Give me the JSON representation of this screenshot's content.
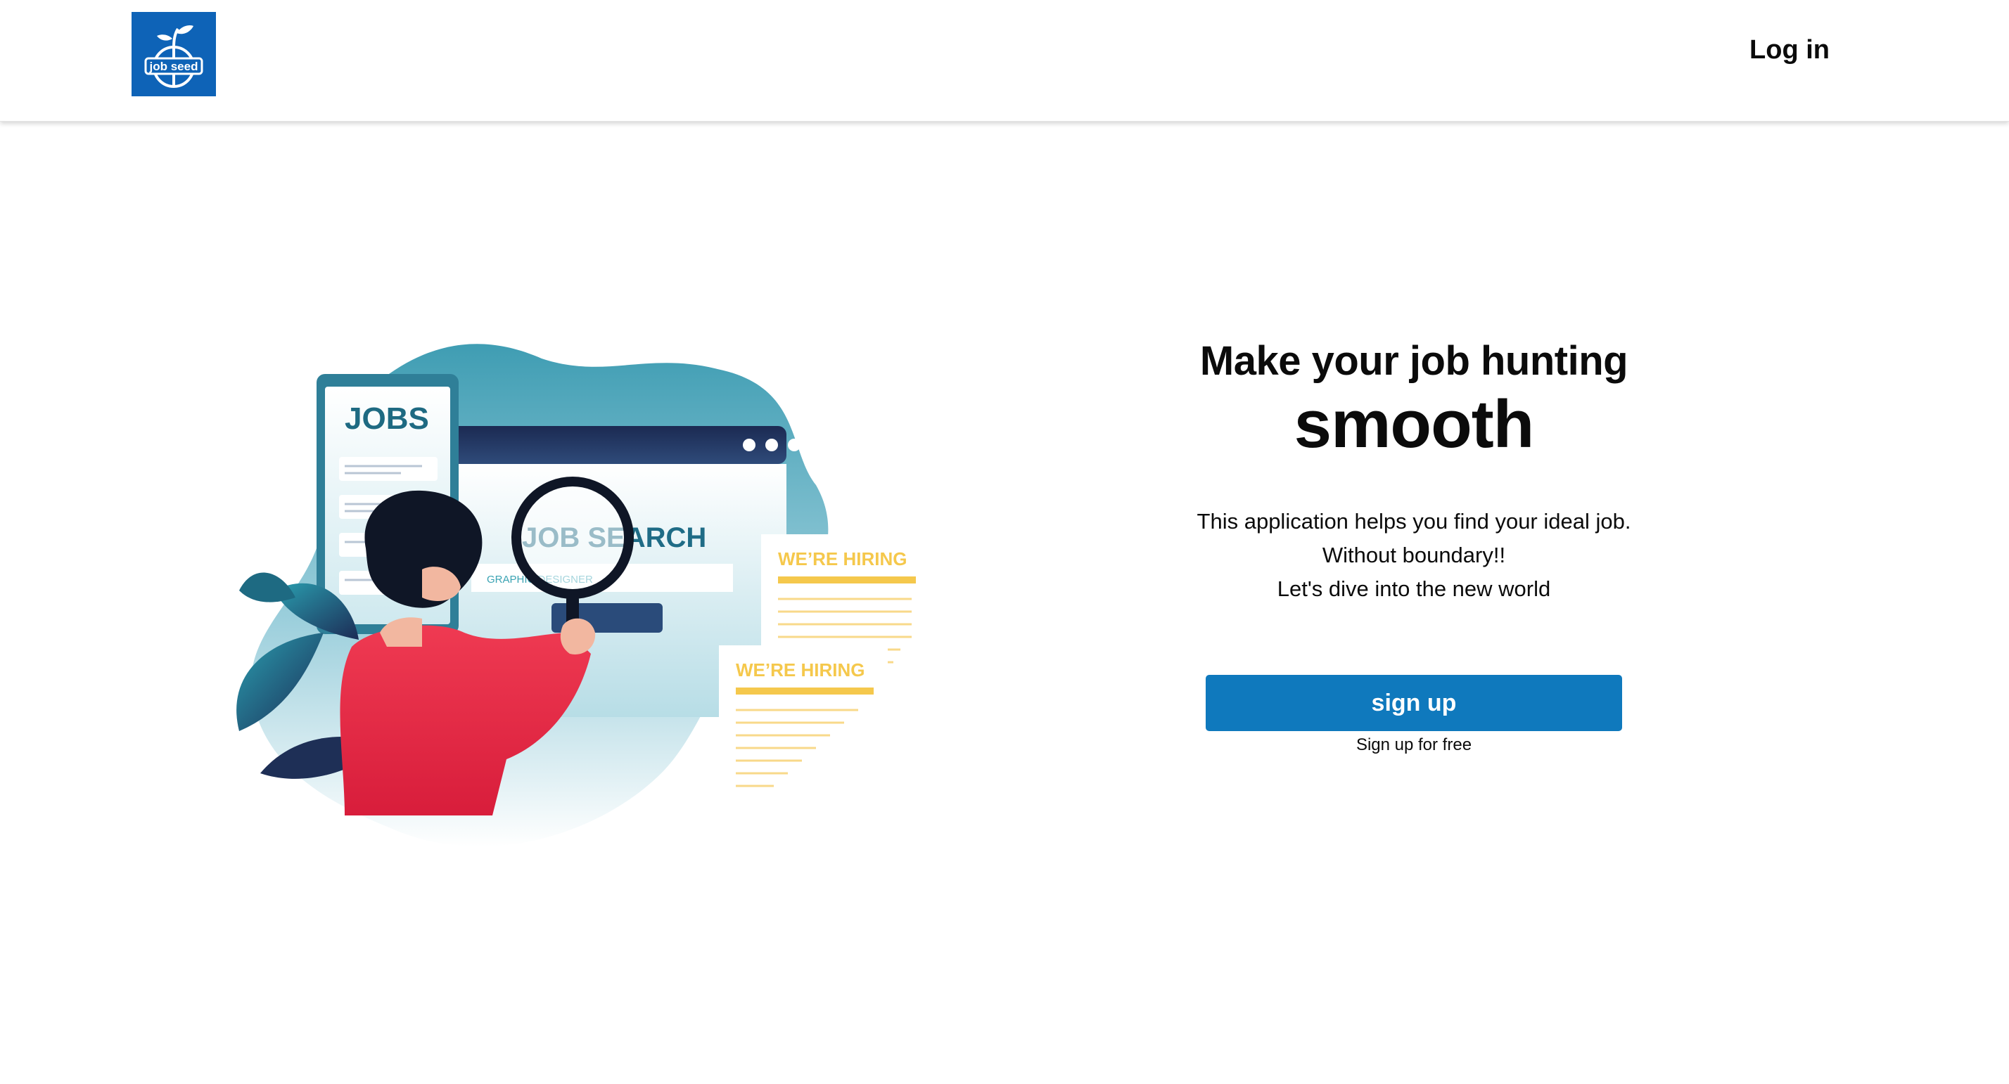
{
  "header": {
    "logo_text": "job seed",
    "login_label": "Log in"
  },
  "illustration": {
    "phone_title": "JOBS",
    "search_title": "JOB SEARCH",
    "search_query": "GRAPHIC DESIGNER",
    "poster1_title": "WE’RE HIRING",
    "poster2_title": "WE’RE HIRING"
  },
  "hero": {
    "headline": "Make your job hunting",
    "headline_emphasis": "smooth",
    "lines": [
      "This application helps you find your ideal job.",
      "Without boundary!!",
      "Let's dive into the new world"
    ],
    "signup_label": "sign up",
    "signup_note": "Sign up for free"
  },
  "colors": {
    "brand_blue": "#0e63b7",
    "button_blue": "#0f79bd",
    "teal": "#4ba3b8",
    "navy": "#1e2f56",
    "shirt_red": "#e8304a",
    "hiring_yellow": "#f5c84c"
  }
}
